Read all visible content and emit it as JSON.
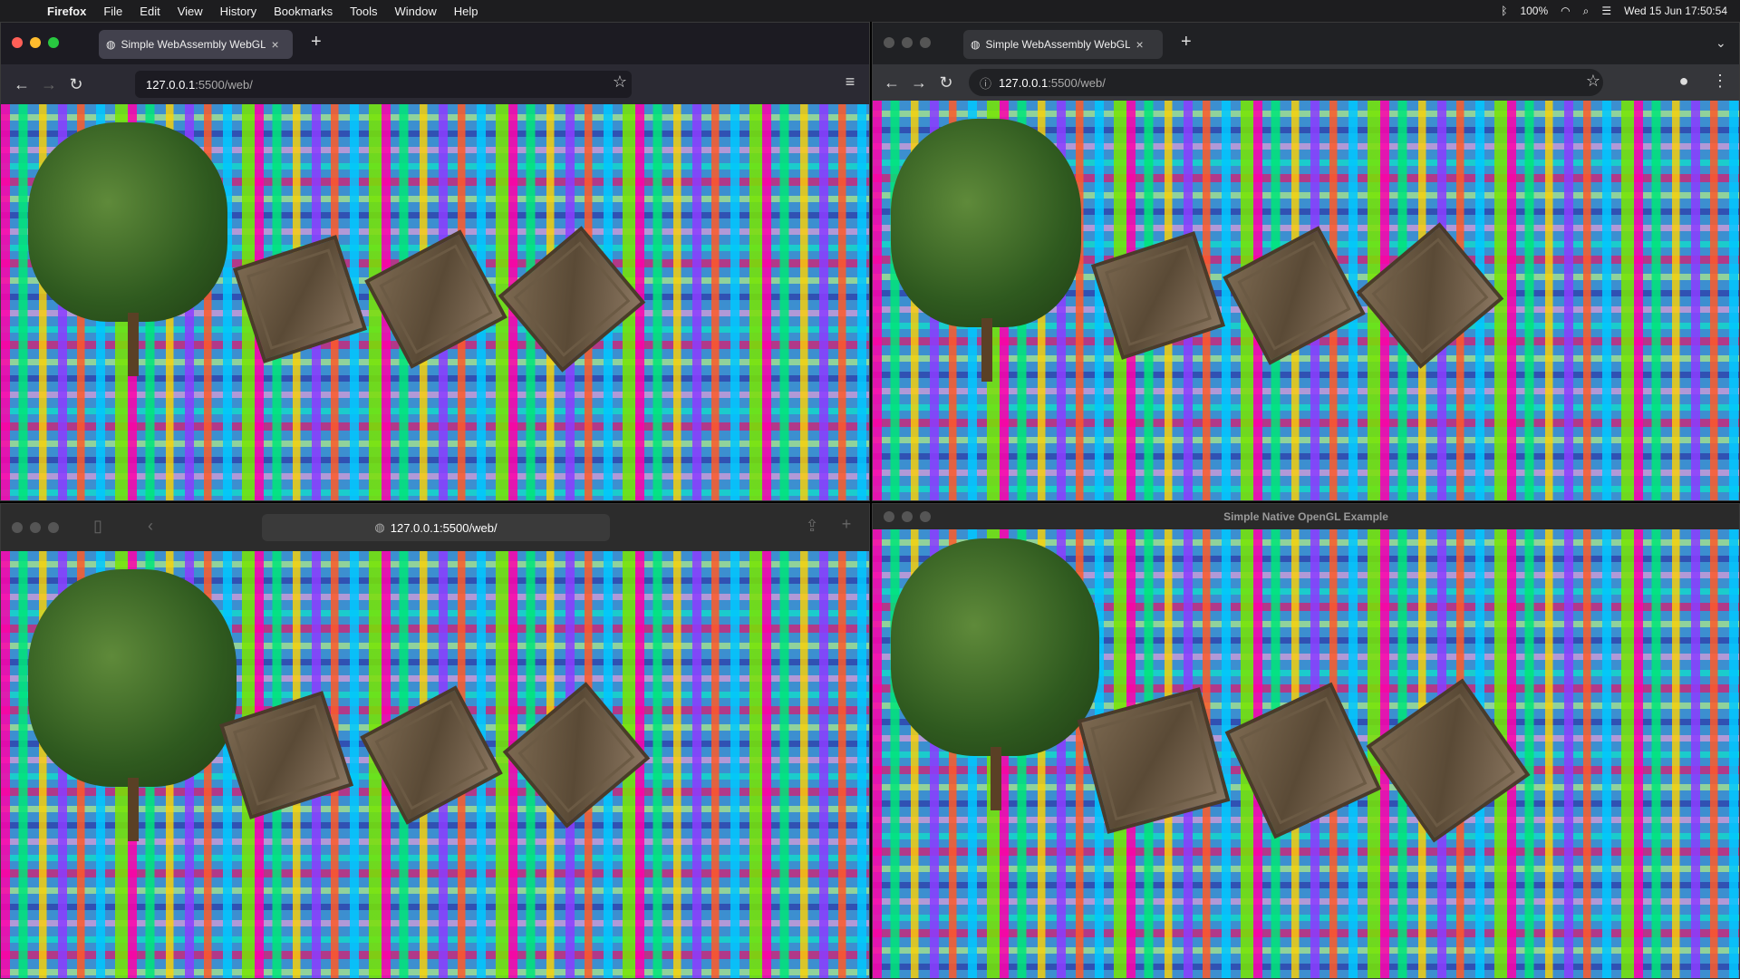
{
  "menubar": {
    "app": "Firefox",
    "items": [
      "File",
      "Edit",
      "View",
      "History",
      "Bookmarks",
      "Tools",
      "Window",
      "Help"
    ],
    "battery": "100%",
    "datetime": "Wed 15 Jun  17:50:54"
  },
  "firefox": {
    "tab_title": "Simple WebAssembly WebGL Ex",
    "url_host": "127.0.0.1",
    "url_rest": ":5500/web/"
  },
  "chrome": {
    "tab_title": "Simple WebAssembly WebGL E",
    "url_host": "127.0.0.1",
    "url_rest": ":5500/web/"
  },
  "safari": {
    "url": "127.0.0.1:5500/web/"
  },
  "native": {
    "title": "Simple Native OpenGL Example"
  },
  "colors": {
    "menubar": "#1d1d1f",
    "firefox_toolbar": "#2b2a33",
    "chrome_toolbar": "#35363a",
    "safari_toolbar": "#2c2c2c"
  },
  "icons": [
    "apple-logo-icon",
    "back-arrow-icon",
    "forward-arrow-icon",
    "reload-icon",
    "star-icon",
    "menu-icon",
    "lock-icon",
    "share-icon",
    "sidebar-icon"
  ]
}
